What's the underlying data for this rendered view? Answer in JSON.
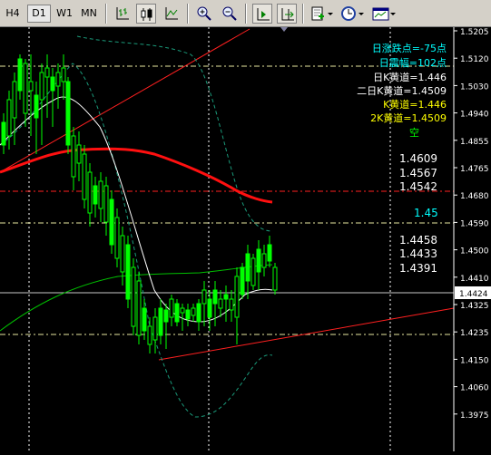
{
  "toolbar": {
    "timeframes": [
      "H4",
      "D1",
      "W1",
      "MN"
    ],
    "active_timeframe": "D1",
    "buttons": [
      "bar-chart-icon",
      "candlestick-icon",
      "line-chart-icon",
      "zoom-in-icon",
      "zoom-out-icon",
      "chart-shift-icon",
      "auto-scroll-icon",
      "indicators-icon",
      "periods-icon",
      "templates-icon"
    ]
  },
  "colors": {
    "background": "#000000",
    "bull_candle": "#00ff00",
    "bear_candle_body": "#000000",
    "ma_red": "#ff0000",
    "ma_white": "#ffffff",
    "ma_green": "#00c000",
    "envelope_dashed": "#00a080",
    "price_axis_text": "#ffffff",
    "info_cyan": "#00ffff",
    "info_white": "#ffffff",
    "info_yellow": "#ffff00",
    "info_green": "#00ff00",
    "level_label_cyan": "#00ffff"
  },
  "info_panel": [
    {
      "text": "日涨跌点=-75点",
      "color": "#00ffff"
    },
    {
      "text": "日震幅=102点",
      "color": "#00ffff"
    },
    {
      "text": "日K黄道=1.446",
      "color": "#ffffff"
    },
    {
      "text": "二日K黄道=1.4509",
      "color": "#ffffff"
    },
    {
      "text": "K黄道=1.446",
      "color": "#ffff00"
    },
    {
      "text": "2K黄道=1.4509",
      "color": "#ffff00"
    },
    {
      "text": "空",
      "color": "#00ff00"
    }
  ],
  "level_labels": [
    {
      "text": "1.4609",
      "color": "#ffffff"
    },
    {
      "text": "1.4567",
      "color": "#ffffff"
    },
    {
      "text": "1.4542",
      "color": "#ffffff"
    },
    {
      "text": "1.45",
      "color": "#00ffff"
    },
    {
      "text": "1.4458",
      "color": "#ffffff"
    },
    {
      "text": "1.4433",
      "color": "#ffffff"
    },
    {
      "text": "1.4391",
      "color": "#ffffff"
    }
  ],
  "price_axis": {
    "ticks": [
      "1.5205",
      "1.5120",
      "1.5030",
      "1.4940",
      "1.4855",
      "1.4765",
      "1.4680",
      "1.4590",
      "1.4500",
      "1.4410",
      "1.4325",
      "1.4235",
      "1.4150",
      "1.4060",
      "1.3975"
    ],
    "current_price": "1.4424"
  }
}
